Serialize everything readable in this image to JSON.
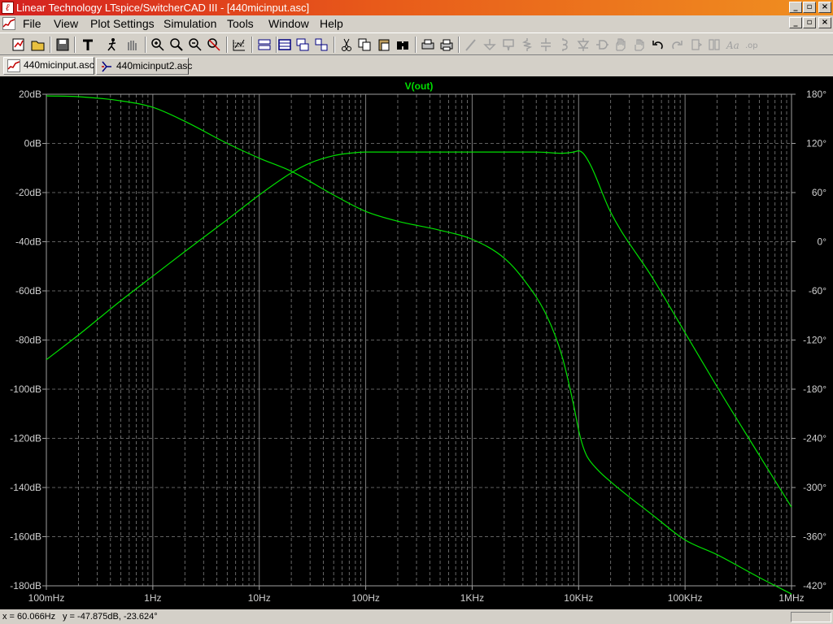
{
  "window": {
    "title": "Linear Technology LTspice/SwitcherCAD III - [440micinput.asc]",
    "app_icon_glyph": "ℓ"
  },
  "menu": {
    "items": [
      "File",
      "View",
      "Plot Settings",
      "Simulation",
      "Tools",
      "Window",
      "Help"
    ]
  },
  "toolbar": {
    "icons": [
      "new-schematic-icon",
      "open-icon",
      "save-icon",
      "control-panel-icon",
      "run-icon",
      "halt-icon",
      "zoom-area-icon",
      "zoom-in-icon",
      "zoom-out-icon",
      "zoom-fit-icon",
      "autorange-icon",
      "tile-horizontal-icon",
      "cascade-icon",
      "tile-vertical-icon",
      "cut-icon",
      "copy-icon",
      "find-icon",
      "print-setup-icon",
      "print-icon",
      "wire-icon",
      "ground-icon",
      "label-icon",
      "resistor-icon",
      "capacitor-icon",
      "inductor-icon",
      "diode-icon",
      "component-icon",
      "move-icon",
      "drag-icon",
      "undo-icon",
      "redo-icon",
      "rotate-icon",
      "mirror-icon",
      "text-icon",
      "spice-directive-icon"
    ]
  },
  "tabs": [
    {
      "label": "440micinput.asc",
      "icon": "waveform-icon",
      "active": true
    },
    {
      "label": "440micinput2.asc",
      "icon": "schematic-icon",
      "active": false
    }
  ],
  "colors": {
    "trace": "#00e000",
    "grid": "#808080",
    "plot_bg": "#000000",
    "axis_text": "#d0d0d0"
  },
  "chart_data": {
    "type": "line",
    "title": "V(out)",
    "x_scale": "log",
    "xlim": [
      0.1,
      1000000
    ],
    "x_tick_labels": [
      "100mHz",
      "1Hz",
      "10Hz",
      "100Hz",
      "1KHz",
      "10KHz",
      "100KHz",
      "1MHz"
    ],
    "ylim": [
      -180,
      20
    ],
    "y_tick_labels": [
      "20dB",
      "0dB",
      "-20dB",
      "-40dB",
      "-60dB",
      "-80dB",
      "-100dB",
      "-120dB",
      "-140dB",
      "-160dB",
      "-180dB"
    ],
    "y2lim": [
      -420,
      180
    ],
    "y2_tick_labels": [
      "180°",
      "120°",
      "60°",
      "0°",
      "-60°",
      "-120°",
      "-180°",
      "-240°",
      "-300°",
      "-360°",
      "-420°"
    ],
    "grid": true,
    "series": [
      {
        "quantity": "magnitude",
        "axis": "left",
        "unit": "dB",
        "x": [
          0.1,
          0.2,
          0.5,
          1,
          2,
          5,
          10,
          20,
          30,
          50,
          70,
          100,
          200,
          500,
          1000,
          2000,
          4000,
          7000,
          9000,
          10000,
          11000,
          13000,
          20000,
          50000,
          100000,
          200000,
          500000,
          1000000
        ],
        "values": [
          -88,
          -78,
          -64,
          -54,
          -44,
          -31,
          -21,
          -12,
          -8,
          -5,
          -4,
          -3.5,
          -3.5,
          -3.5,
          -3.5,
          -3.5,
          -3.5,
          -4,
          -3.5,
          -3,
          -4,
          -9,
          -28,
          -55,
          -77,
          -99,
          -127,
          -148
        ]
      },
      {
        "quantity": "phase",
        "axis": "right",
        "unit": "deg",
        "x": [
          0.1,
          0.2,
          0.5,
          1,
          2,
          5,
          10,
          20,
          50,
          100,
          200,
          500,
          1000,
          2000,
          3000,
          5000,
          7000,
          9000,
          10000,
          11000,
          12000,
          15000,
          20000,
          50000,
          100000,
          200000,
          500000,
          1000000
        ],
        "values": [
          178,
          177,
          172,
          164,
          147,
          120,
          102,
          86,
          57,
          37,
          25,
          14,
          3,
          -20,
          -45,
          -90,
          -140,
          -200,
          -230,
          -250,
          -262,
          -278,
          -293,
          -334,
          -364,
          -382,
          -410,
          -430
        ]
      }
    ]
  },
  "status": {
    "x_readout": "x = 60.066Hz",
    "y_readout": "y = -47.875dB, -23.624°"
  }
}
